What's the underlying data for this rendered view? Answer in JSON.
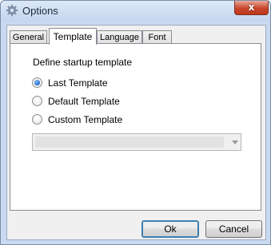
{
  "window": {
    "title": "Options",
    "close_label": "x"
  },
  "tabs": [
    {
      "label": "General",
      "active": false
    },
    {
      "label": "Template",
      "active": true
    },
    {
      "label": "Language",
      "active": false
    },
    {
      "label": "Font",
      "active": false
    }
  ],
  "template_panel": {
    "group_label": "Define startup template",
    "options": [
      {
        "label": "Last Template",
        "selected": true
      },
      {
        "label": "Default Template",
        "selected": false
      },
      {
        "label": "Custom Template",
        "selected": false
      }
    ],
    "custom_template_select": {
      "value": "",
      "enabled": false
    }
  },
  "buttons": {
    "ok_label": "Ok",
    "cancel_label": "Cancel"
  },
  "colors": {
    "title_bar": "#c9daf0",
    "close_button": "#c7462c",
    "radio_selected": "#1a64c8",
    "default_button_border": "#3c7fb1"
  },
  "icons": {
    "app": "gear-icon",
    "close": "close-icon",
    "dropdown": "chevron-down-icon"
  }
}
